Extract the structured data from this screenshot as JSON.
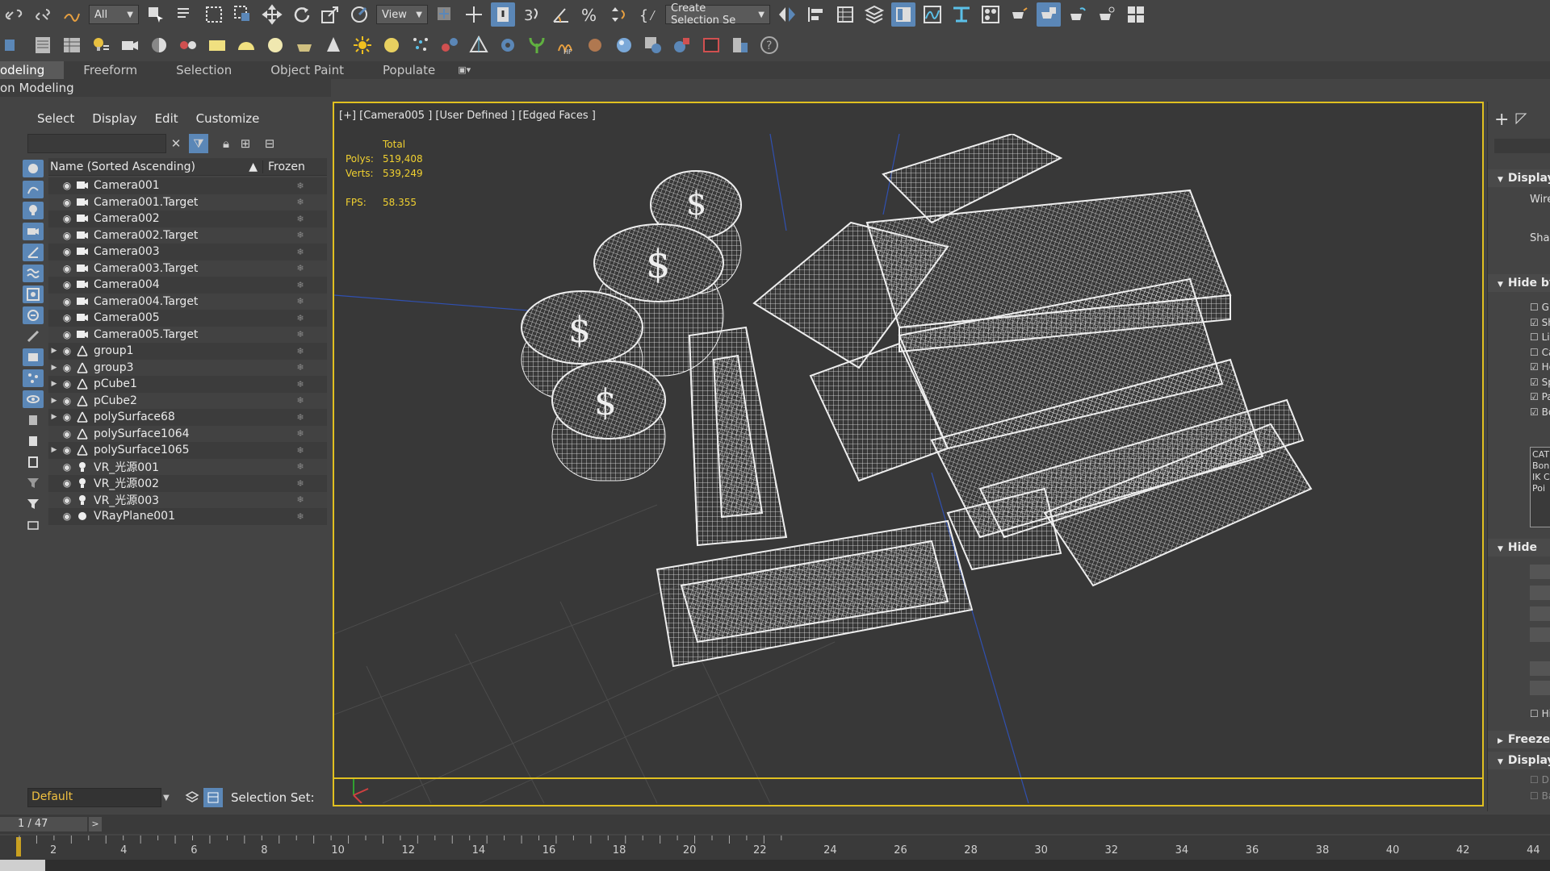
{
  "toolbar": {
    "selection_filter": "All",
    "reference_coord": "View",
    "named_selection": "Create Selection Se"
  },
  "ribbon": {
    "tabs": [
      "odeling",
      "Freeform",
      "Selection",
      "Object Paint",
      "Populate"
    ],
    "sub_label": "on Modeling"
  },
  "explorer": {
    "menu": [
      "Select",
      "Display",
      "Edit",
      "Customize"
    ],
    "search_value": "",
    "col_name": "Name (Sorted Ascending)",
    "col_sort": "▲",
    "col_frozen": "Frozen",
    "items": [
      {
        "name": "Camera001",
        "type": "camera",
        "expand": false
      },
      {
        "name": "Camera001.Target",
        "type": "camera",
        "expand": false
      },
      {
        "name": "Camera002",
        "type": "camera",
        "expand": false
      },
      {
        "name": "Camera002.Target",
        "type": "camera",
        "expand": false
      },
      {
        "name": "Camera003",
        "type": "camera",
        "expand": false
      },
      {
        "name": "Camera003.Target",
        "type": "camera",
        "expand": false
      },
      {
        "name": "Camera004",
        "type": "camera",
        "expand": false
      },
      {
        "name": "Camera004.Target",
        "type": "camera",
        "expand": false
      },
      {
        "name": "Camera005",
        "type": "camera",
        "expand": false
      },
      {
        "name": "Camera005.Target",
        "type": "camera",
        "expand": false
      },
      {
        "name": "group1",
        "type": "geometry",
        "expand": true
      },
      {
        "name": "group3",
        "type": "geometry",
        "expand": true
      },
      {
        "name": "pCube1",
        "type": "geometry",
        "expand": true
      },
      {
        "name": "pCube2",
        "type": "geometry",
        "expand": true
      },
      {
        "name": "polySurface68",
        "type": "geometry",
        "expand": true
      },
      {
        "name": "polySurface1064",
        "type": "geometry",
        "expand": false
      },
      {
        "name": "polySurface1065",
        "type": "geometry",
        "expand": true
      },
      {
        "name": "VR_光源001",
        "type": "light",
        "expand": false
      },
      {
        "name": "VR_光源002",
        "type": "light",
        "expand": false
      },
      {
        "name": "VR_光源003",
        "type": "light",
        "expand": false
      },
      {
        "name": "VRayPlane001",
        "type": "plane",
        "expand": false
      }
    ],
    "layer": "Default",
    "selection_set_label": "Selection Set:"
  },
  "viewport": {
    "label": "[+] [Camera005 ] [User Defined ] [Edged Faces ]",
    "stats": {
      "total_label": "Total",
      "polys_label": "Polys:",
      "polys": "519,408",
      "verts_label": "Verts:",
      "verts": "539,249",
      "fps_label": "FPS:",
      "fps": "58.355"
    }
  },
  "command_panel": {
    "sections": [
      {
        "label": "Display",
        "expanded": true
      },
      {
        "label": "Hide by",
        "expanded": true
      },
      {
        "label": "Hide",
        "expanded": true
      },
      {
        "label": "Freeze",
        "expanded": false
      },
      {
        "label": "Display",
        "expanded": true
      }
    ],
    "display_items": [
      "Wiref",
      "Shad"
    ],
    "hide_by_checks": [
      {
        "label": "G",
        "checked": false
      },
      {
        "label": "Sh",
        "checked": true
      },
      {
        "label": "Li",
        "checked": false
      },
      {
        "label": "Ca",
        "checked": false
      },
      {
        "label": "He",
        "checked": true
      },
      {
        "label": "Sp",
        "checked": true
      },
      {
        "label": "Pa",
        "checked": true
      },
      {
        "label": "Bo",
        "checked": true
      }
    ],
    "list_items": [
      "CAT",
      "Bon",
      "IK C",
      "Poi"
    ],
    "hide_check": "Hi",
    "display2_checks": [
      "Di",
      "Ba"
    ]
  },
  "timeline": {
    "frame": "1 / 47",
    "next": ">",
    "tick_labels": [
      "2",
      "4",
      "6",
      "8",
      "10",
      "12",
      "14",
      "16",
      "18",
      "20",
      "22",
      "24",
      "26",
      "28",
      "30",
      "32",
      "34",
      "36",
      "38",
      "40",
      "42",
      "44"
    ]
  },
  "colors": {
    "accent": "#5b87b7",
    "viewport_border": "#e0c020",
    "stats_text": "#f0d030",
    "layer_text": "#f0c040"
  }
}
